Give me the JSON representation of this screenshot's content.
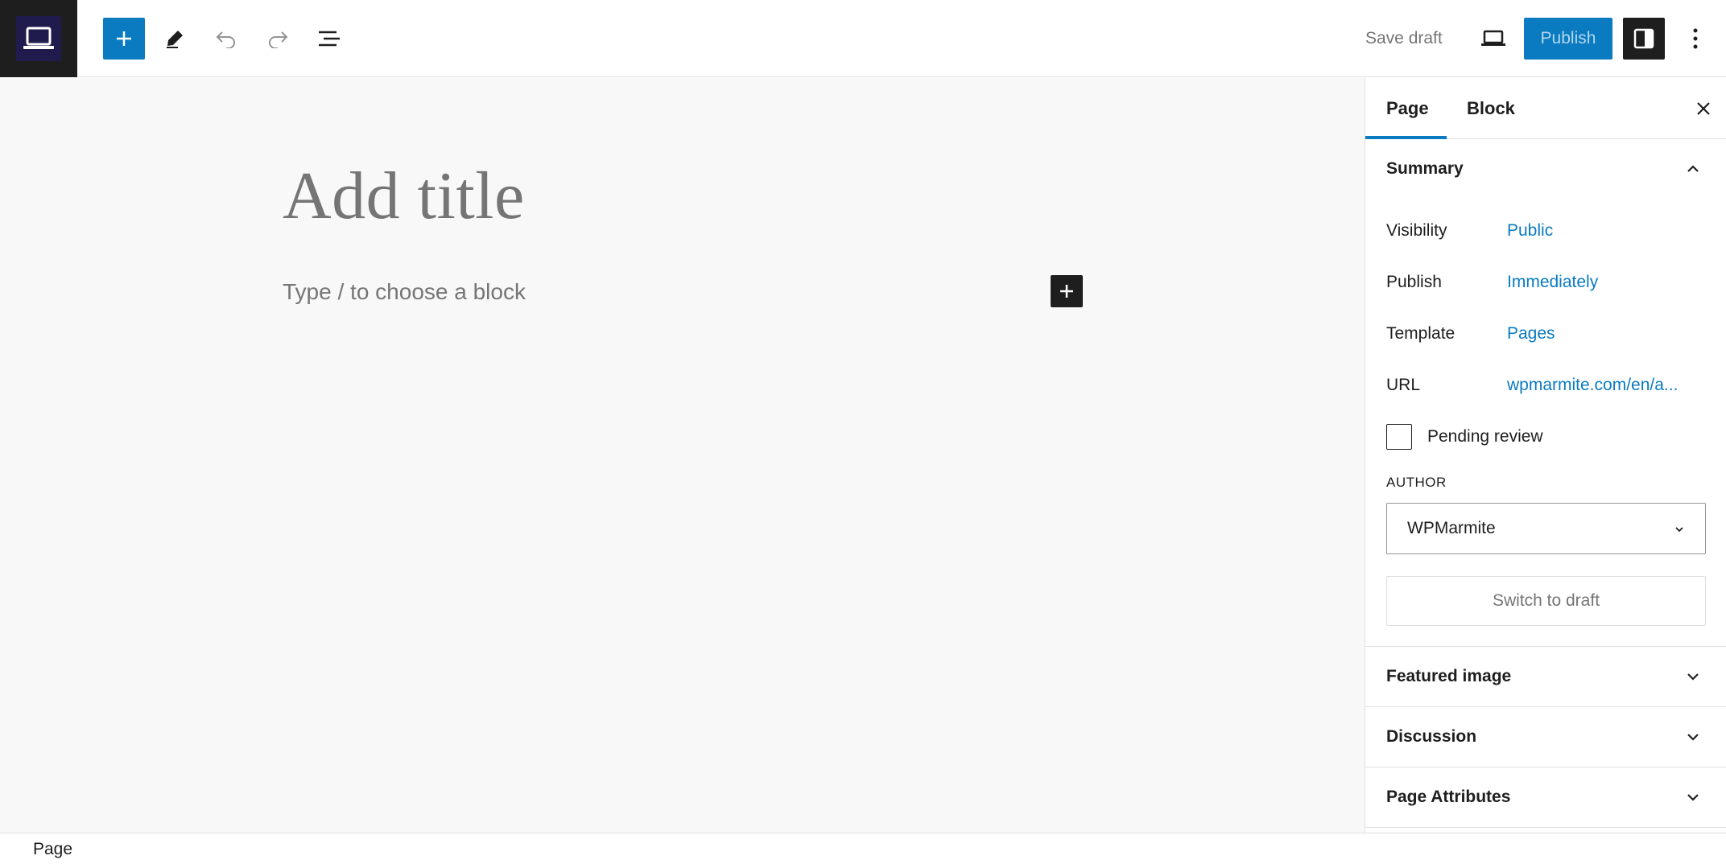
{
  "toolbar": {
    "logo_icon": "laptop-icon",
    "add_icon": "plus-icon",
    "edit_icon": "pencil-icon",
    "undo_icon": "undo-icon",
    "redo_icon": "redo-icon",
    "list_view_icon": "list-view-icon",
    "save_draft_label": "Save draft",
    "preview_icon": "laptop-icon",
    "publish_label": "Publish",
    "settings_icon": "sidebar-icon",
    "options_icon": "more-vertical-icon",
    "accent_color": "#0a7bc0"
  },
  "editor": {
    "title_placeholder": "Add title",
    "block_placeholder": "Type / to choose a block",
    "inline_add_icon": "plus-icon"
  },
  "sidebar": {
    "tabs": [
      {
        "label": "Page",
        "active": true
      },
      {
        "label": "Block",
        "active": false
      }
    ],
    "close_icon": "close-icon",
    "summary": {
      "title": "Summary",
      "expanded": true,
      "rows": [
        {
          "label": "Visibility",
          "value": "Public"
        },
        {
          "label": "Publish",
          "value": "Immediately"
        },
        {
          "label": "Template",
          "value": "Pages"
        },
        {
          "label": "URL",
          "value": "wpmarmite.com/en/a..."
        }
      ],
      "pending_review_label": "Pending review",
      "pending_review_checked": false,
      "author_label": "AUTHOR",
      "author_value": "WPMarmite",
      "switch_to_draft_label": "Switch to draft"
    },
    "panels": [
      {
        "title": "Featured image",
        "expanded": false
      },
      {
        "title": "Discussion",
        "expanded": false
      },
      {
        "title": "Page Attributes",
        "expanded": false
      }
    ]
  },
  "footer": {
    "breadcrumb": "Page"
  }
}
